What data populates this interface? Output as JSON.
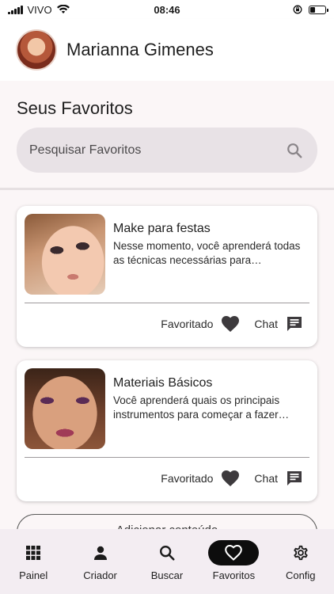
{
  "status_bar": {
    "carrier": "VIVO",
    "time": "08:46",
    "battery_level": 0.35
  },
  "header": {
    "user_name": "Marianna Gimenes"
  },
  "page": {
    "title": "Seus Favoritos"
  },
  "search": {
    "placeholder": "Pesquisar Favoritos",
    "icon": "search-icon"
  },
  "cards": [
    {
      "title": "Make para festas",
      "description": "Nesse momento, você aprenderá todas as técnicas necessárias para maquiagem",
      "favorite_label": "Favoritado",
      "chat_label": "Chat"
    },
    {
      "title": "Materiais Básicos",
      "description": "Você aprenderá quais os principais instrumentos  para começar a fazer qualquer",
      "favorite_label": "Favoritado",
      "chat_label": "Chat"
    }
  ],
  "add_button": {
    "label": "Adicionar conteúdo"
  },
  "bottom_nav": {
    "items": [
      {
        "label": "Painel",
        "icon": "grid-icon"
      },
      {
        "label": "Criador",
        "icon": "person-icon"
      },
      {
        "label": "Buscar",
        "icon": "search-icon"
      },
      {
        "label": "Favoritos",
        "icon": "heart-icon",
        "active": true
      },
      {
        "label": "Config",
        "icon": "gear-icon"
      }
    ]
  },
  "colors": {
    "background": "#fbf6f7",
    "nav_background": "#f3edf2",
    "active_pill": "#0d0d0d",
    "search_background": "#e8e2e6"
  }
}
